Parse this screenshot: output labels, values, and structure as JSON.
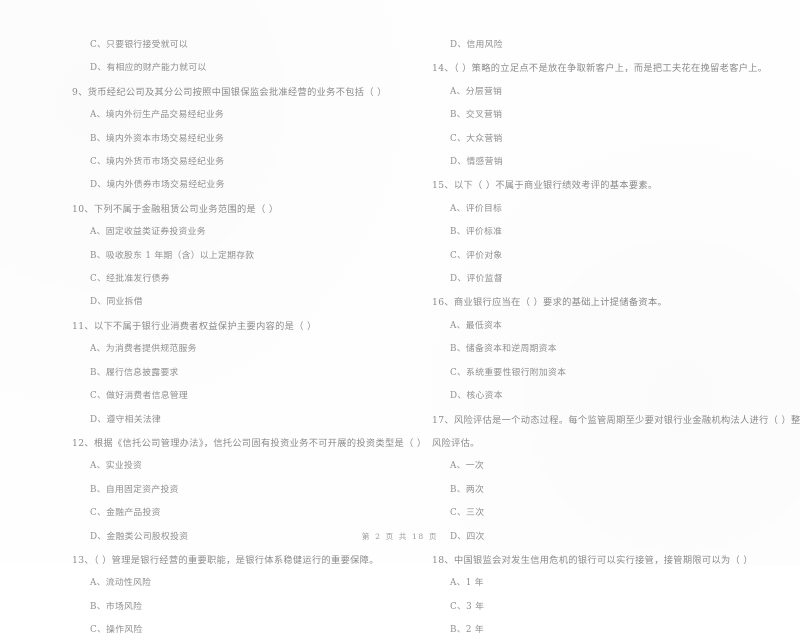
{
  "document": {
    "type": "exam-paper",
    "language": "zh-CN",
    "footer": "第 2 页 共 18 页"
  },
  "left_column": {
    "orphan_options": [
      "C、只要银行接受就可以",
      "D、有相应的财产能力就可以"
    ],
    "questions": [
      {
        "number": "9、",
        "stem": "货币经纪公司及其分公司按照中国银保监会批准经营的业务不包括（        ）",
        "options": [
          "A、境内外衍生产品交易经纪业务",
          "B、境内外资本市场交易经纪业务",
          "C、境内外货币市场交易经纪业务",
          "D、境内外债券市场交易经纪业务"
        ]
      },
      {
        "number": "10、",
        "stem": "下列不属于金融租赁公司业务范围的是（        ）",
        "options": [
          "A、固定收益类证券投资业务",
          "B、吸收股东 1 年期（含）以上定期存款",
          "C、经批准发行债券",
          "D、同业拆借"
        ]
      },
      {
        "number": "11、",
        "stem": "以下不属于银行业消费者权益保护主要内容的是（        ）",
        "options": [
          "A、为消费者提供规范服务",
          "B、履行信息披露要求",
          "C、做好消费者信息管理",
          "D、遵守相关法律"
        ]
      },
      {
        "number": "12、",
        "stem": "根据《信托公司管理办法》，信托公司固有投资业务不可开展的投资类型是（        ）",
        "options": [
          "A、实业投资",
          "B、自用固定资产投资",
          "C、金融产品投资",
          "D、金融类公司股权投资"
        ]
      },
      {
        "number": "13、",
        "stem": "（        ）管理是银行经营的重要职能，是银行体系稳健运行的重要保障。",
        "options": [
          "A、流动性风险",
          "B、市场风险",
          "C、操作风险"
        ]
      }
    ]
  },
  "right_column": {
    "orphan_options": [
      "D、信用风险"
    ],
    "questions": [
      {
        "number": "14、",
        "stem": "（        ）策略的立足点不是放在争取新客户上，而是把工夫花在挽留老客户上。",
        "options": [
          "A、分层营销",
          "B、交叉营销",
          "C、大众营销",
          "D、情感营销"
        ]
      },
      {
        "number": "15、",
        "stem": "以下（        ）不属于商业银行绩效考评的基本要素。",
        "options": [
          "A、评价目标",
          "B、评价标准",
          "C、评价对象",
          "D、评价监督"
        ]
      },
      {
        "number": "16、",
        "stem": "商业银行应当在（        ）要求的基础上计提储备资本。",
        "options": [
          "A、最低资本",
          "B、储备资本和逆周期资本",
          "C、系统重要性银行附加资本",
          "D、核心资本"
        ]
      },
      {
        "number": "17、",
        "stem": "风险评估是一个动态过程。每个监管周期至少要对银行业金融机构法人进行（        ）整体",
        "stem_continued": "风险评估。",
        "options": [
          "A、一次",
          "B、两次",
          "C、三次",
          "D、四次"
        ]
      },
      {
        "number": "18、",
        "stem": "中国银监会对发生信用危机的银行可以实行接管，接管期限可以为（        ）",
        "options": [
          "A、1 年",
          "C、3 年",
          "B、2 年"
        ]
      }
    ]
  }
}
